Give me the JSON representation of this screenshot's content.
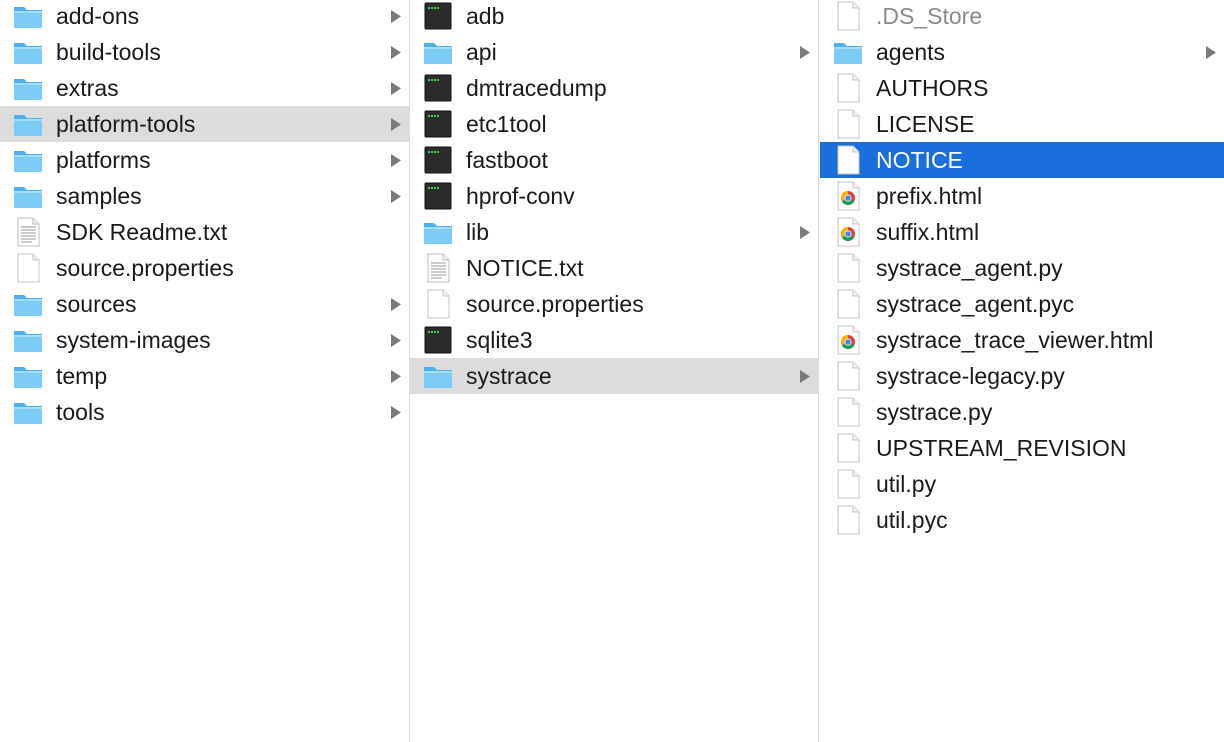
{
  "columns": [
    {
      "items": [
        {
          "label": "add-ons",
          "icon": "folder-icon",
          "has_children": true,
          "state": "normal"
        },
        {
          "label": "build-tools",
          "icon": "folder-icon",
          "has_children": true,
          "state": "normal"
        },
        {
          "label": "extras",
          "icon": "folder-icon",
          "has_children": true,
          "state": "normal"
        },
        {
          "label": "platform-tools",
          "icon": "folder-icon",
          "has_children": true,
          "state": "selected-inactive"
        },
        {
          "label": "platforms",
          "icon": "folder-icon",
          "has_children": true,
          "state": "normal"
        },
        {
          "label": "samples",
          "icon": "folder-icon",
          "has_children": true,
          "state": "normal"
        },
        {
          "label": "SDK Readme.txt",
          "icon": "text-document-icon",
          "has_children": false,
          "state": "normal"
        },
        {
          "label": "source.properties",
          "icon": "blank-document-icon",
          "has_children": false,
          "state": "normal"
        },
        {
          "label": "sources",
          "icon": "folder-icon",
          "has_children": true,
          "state": "normal"
        },
        {
          "label": "system-images",
          "icon": "folder-icon",
          "has_children": true,
          "state": "normal"
        },
        {
          "label": "temp",
          "icon": "folder-icon",
          "has_children": true,
          "state": "normal"
        },
        {
          "label": "tools",
          "icon": "folder-icon",
          "has_children": true,
          "state": "normal"
        }
      ]
    },
    {
      "items": [
        {
          "label": "adb",
          "icon": "terminal-exec-icon",
          "has_children": false,
          "state": "normal"
        },
        {
          "label": "api",
          "icon": "folder-icon",
          "has_children": true,
          "state": "normal"
        },
        {
          "label": "dmtracedump",
          "icon": "terminal-exec-icon",
          "has_children": false,
          "state": "normal"
        },
        {
          "label": "etc1tool",
          "icon": "terminal-exec-icon",
          "has_children": false,
          "state": "normal"
        },
        {
          "label": "fastboot",
          "icon": "terminal-exec-icon",
          "has_children": false,
          "state": "normal"
        },
        {
          "label": "hprof-conv",
          "icon": "terminal-exec-icon",
          "has_children": false,
          "state": "normal"
        },
        {
          "label": "lib",
          "icon": "folder-icon",
          "has_children": true,
          "state": "normal"
        },
        {
          "label": "NOTICE.txt",
          "icon": "text-document-icon",
          "has_children": false,
          "state": "normal"
        },
        {
          "label": "source.properties",
          "icon": "blank-document-icon",
          "has_children": false,
          "state": "normal"
        },
        {
          "label": "sqlite3",
          "icon": "terminal-exec-icon",
          "has_children": false,
          "state": "normal"
        },
        {
          "label": "systrace",
          "icon": "folder-icon",
          "has_children": true,
          "state": "selected-inactive"
        }
      ]
    },
    {
      "items": [
        {
          "label": ".DS_Store",
          "icon": "blank-document-icon",
          "has_children": false,
          "state": "dimmed"
        },
        {
          "label": "agents",
          "icon": "folder-icon",
          "has_children": true,
          "state": "normal"
        },
        {
          "label": "AUTHORS",
          "icon": "blank-document-icon",
          "has_children": false,
          "state": "normal"
        },
        {
          "label": "LICENSE",
          "icon": "blank-document-icon",
          "has_children": false,
          "state": "normal"
        },
        {
          "label": "NOTICE",
          "icon": "blank-document-icon",
          "has_children": false,
          "state": "selected-active"
        },
        {
          "label": "prefix.html",
          "icon": "chrome-html-icon",
          "has_children": false,
          "state": "normal"
        },
        {
          "label": "suffix.html",
          "icon": "chrome-html-icon",
          "has_children": false,
          "state": "normal"
        },
        {
          "label": "systrace_agent.py",
          "icon": "blank-document-icon",
          "has_children": false,
          "state": "normal"
        },
        {
          "label": "systrace_agent.pyc",
          "icon": "blank-document-icon",
          "has_children": false,
          "state": "normal"
        },
        {
          "label": "systrace_trace_viewer.html",
          "icon": "chrome-html-icon",
          "has_children": false,
          "state": "normal"
        },
        {
          "label": "systrace-legacy.py",
          "icon": "blank-document-icon",
          "has_children": false,
          "state": "normal"
        },
        {
          "label": "systrace.py",
          "icon": "blank-document-icon",
          "has_children": false,
          "state": "normal"
        },
        {
          "label": "UPSTREAM_REVISION",
          "icon": "blank-document-icon",
          "has_children": false,
          "state": "normal"
        },
        {
          "label": "util.py",
          "icon": "blank-document-icon",
          "has_children": false,
          "state": "normal"
        },
        {
          "label": "util.pyc",
          "icon": "blank-document-icon",
          "has_children": false,
          "state": "normal"
        }
      ]
    }
  ],
  "colors": {
    "selection_active": "#1a6fdc",
    "selection_inactive": "#dcdcdc",
    "folder_blue": "#6ec2f3",
    "arrow_gray": "#7a7a7a"
  }
}
